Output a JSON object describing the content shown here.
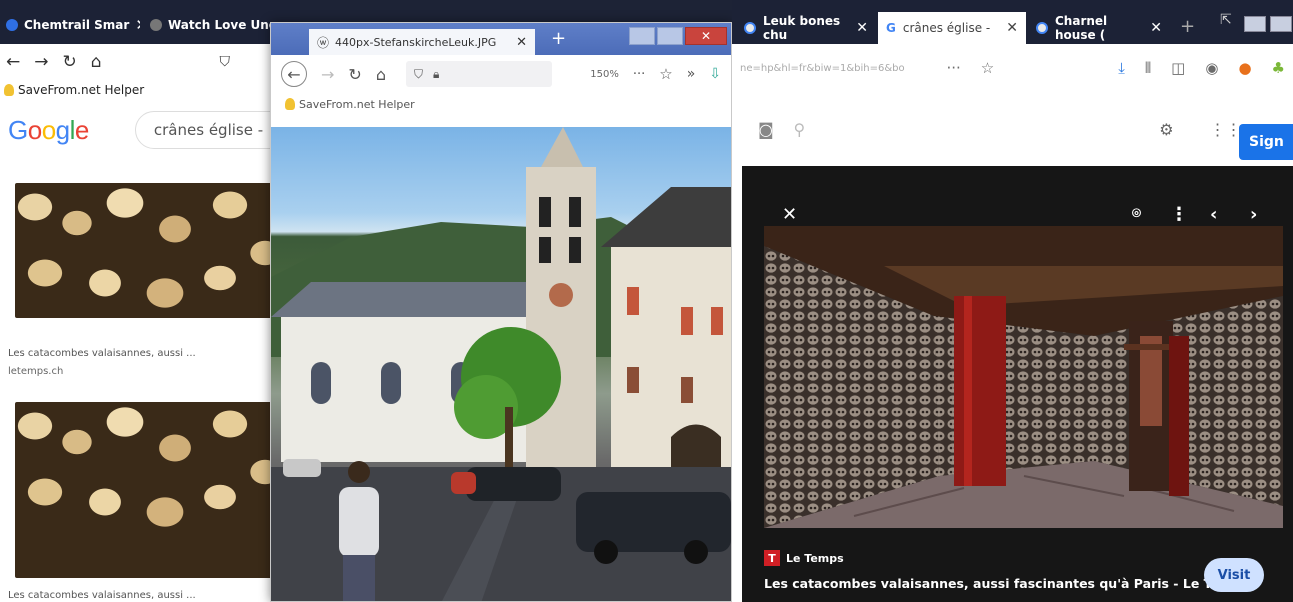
{
  "left_window": {
    "tabs": [
      {
        "label": "Chemtrail Smar"
      },
      {
        "label": "Watch Love Unc"
      }
    ],
    "bookmark": "SaveFrom.net Helper",
    "google_logo": "Google",
    "search_value": "crânes église -",
    "results": [
      {
        "title": "Les catacombes valaisannes, aussi ...",
        "source": "letemps.ch"
      },
      {
        "title": "Les catacombes valaisannes, aussi ..."
      }
    ]
  },
  "middle_window": {
    "tab_title": "440px-StefanskircheLeuk.JPG",
    "zoom": "150%",
    "bookmark": "SaveFrom.net Helper"
  },
  "right_window": {
    "tabs": [
      {
        "label": "Leuk bones chu"
      },
      {
        "label": "crânes église -",
        "active": true
      },
      {
        "label": "Charnel house ("
      }
    ],
    "url": "ne=hp&hl=fr&biw=1&bih=6&bo",
    "sign_in": "Sign",
    "source": "Le Temps",
    "caption": "Les catacombes valaisannes, aussi fascinantes qu'à Paris - Le T...",
    "visit": "Visit"
  },
  "colors": {
    "tab_bg": "#1c2236",
    "google_blue": "#4285f4",
    "google_red": "#ea4335",
    "google_yellow": "#fbbc05",
    "google_green": "#34a853",
    "sign_in_bg": "#1a73e8",
    "source_icon": "#d01f25"
  }
}
